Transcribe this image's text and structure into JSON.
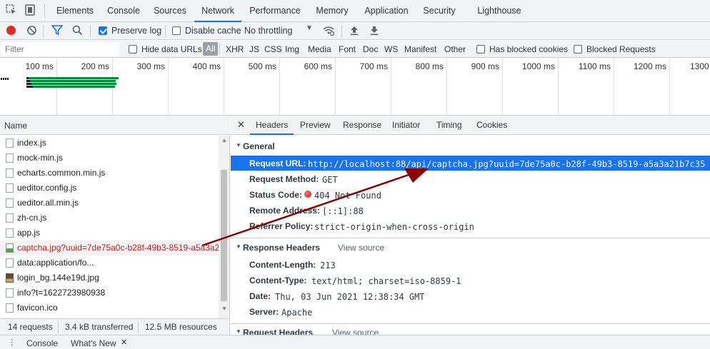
{
  "tabs": [
    "Elements",
    "Console",
    "Sources",
    "Network",
    "Performance",
    "Memory",
    "Application",
    "Security",
    "Lighthouse"
  ],
  "toolbar": {
    "preserve_log": "Preserve log",
    "disable_cache": "Disable cache",
    "throttling": "No throttling"
  },
  "filter": {
    "placeholder": "Filter",
    "hide_data_urls": "Hide data URLs",
    "types": [
      "All",
      "XHR",
      "JS",
      "CSS",
      "Img",
      "Media",
      "Font",
      "Doc",
      "WS",
      "Manifest",
      "Other"
    ],
    "has_blocked_cookies": "Has blocked cookies",
    "blocked_requests": "Blocked Requests"
  },
  "timeline": {
    "ticks": [
      "100 ms",
      "200 ms",
      "300 ms",
      "400 ms",
      "500 ms",
      "600 ms",
      "700 ms",
      "800 ms",
      "900 ms",
      "1000 ms",
      "1100 ms",
      "1200 ms",
      "1300"
    ]
  },
  "requests": {
    "header": "Name",
    "rows": [
      "index.js",
      "mock-min.js",
      "echarts.common.min.js",
      "ueditor.config.js",
      "ueditor.all.min.js",
      "zh-cn.js",
      "app.js",
      "captcha.jpg?uuid=7de75a0c-b28f-49b3-8519-a5a3a2",
      "data:application/fo...",
      "login_bg.144e19d.jpg",
      "info?t=1622723980938",
      "favicon.ico"
    ]
  },
  "status": {
    "requests": "14 requests",
    "transferred": "3.4 kB transferred",
    "resources": "12.5 MB resources"
  },
  "drawer": {
    "console": "Console",
    "whats_new": "What's New"
  },
  "details": {
    "tabs": [
      "Headers",
      "Preview",
      "Response",
      "Initiator",
      "Timing",
      "Cookies"
    ],
    "general": {
      "title": "General",
      "request_url_k": "Request URL:",
      "request_url_v": "http://localhost:88/api/captcha.jpg?uuid=7de75a0c-b28f-49b3-8519-a5a3a21b7c35",
      "method_k": "Request Method:",
      "method_v": "GET",
      "status_k": "Status Code:",
      "status_v": "404 Not Found",
      "remote_k": "Remote Address:",
      "remote_v": "[::1]:88",
      "referrer_k": "Referrer Policy:",
      "referrer_v": "strict-origin-when-cross-origin"
    },
    "response_headers": {
      "title": "Response Headers",
      "view_source": "View source",
      "content_length_k": "Content-Length:",
      "content_length_v": "213",
      "content_type_k": "Content-Type:",
      "content_type_v": "text/html; charset=iso-8859-1",
      "date_k": "Date:",
      "date_v": "Thu, 03 Jun 2021 12:38:34 GMT",
      "server_k": "Server:",
      "server_v": "Apache"
    },
    "request_headers": {
      "title": "Request Headers",
      "view_source": "View source"
    }
  },
  "colors": {
    "accent": "#1a73e8",
    "error": "#c5221f",
    "arrow": "#8b0000",
    "waterfall": "#0a8a3e"
  }
}
